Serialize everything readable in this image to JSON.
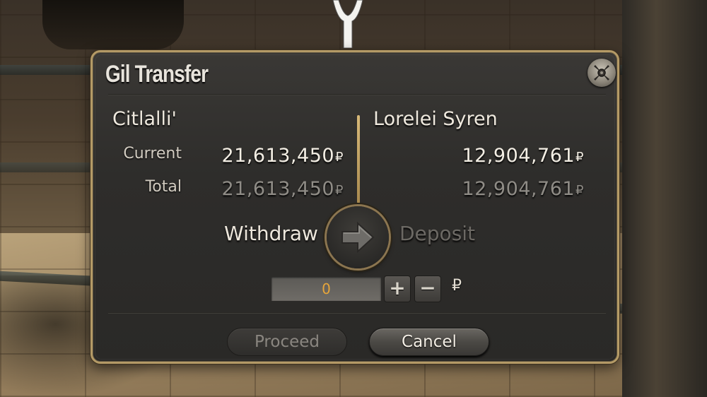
{
  "window": {
    "title": "Gil Transfer"
  },
  "source": {
    "name": "Citlalli'",
    "current_label": "Current",
    "current_value": "21,613,450",
    "total_label": "Total",
    "total_value": "21,613,450"
  },
  "target": {
    "name": "Lorelei Syren",
    "current_value": "12,904,761",
    "total_value": "12,904,761"
  },
  "currency_symbol": "₽",
  "mode": {
    "withdraw_label": "Withdraw",
    "deposit_label": "Deposit",
    "active": "withdraw"
  },
  "amount": {
    "value": "0"
  },
  "stepper": {
    "plus_label": "+",
    "minus_label": "−"
  },
  "buttons": {
    "proceed_label": "Proceed",
    "cancel_label": "Cancel"
  },
  "colors": {
    "frame_gold": "#b49a66",
    "amount_text": "#e6a53a",
    "panel_bg": "#2e2d2b"
  },
  "icons": {
    "close": "close-icon",
    "toggle": "arrow-right-icon"
  }
}
